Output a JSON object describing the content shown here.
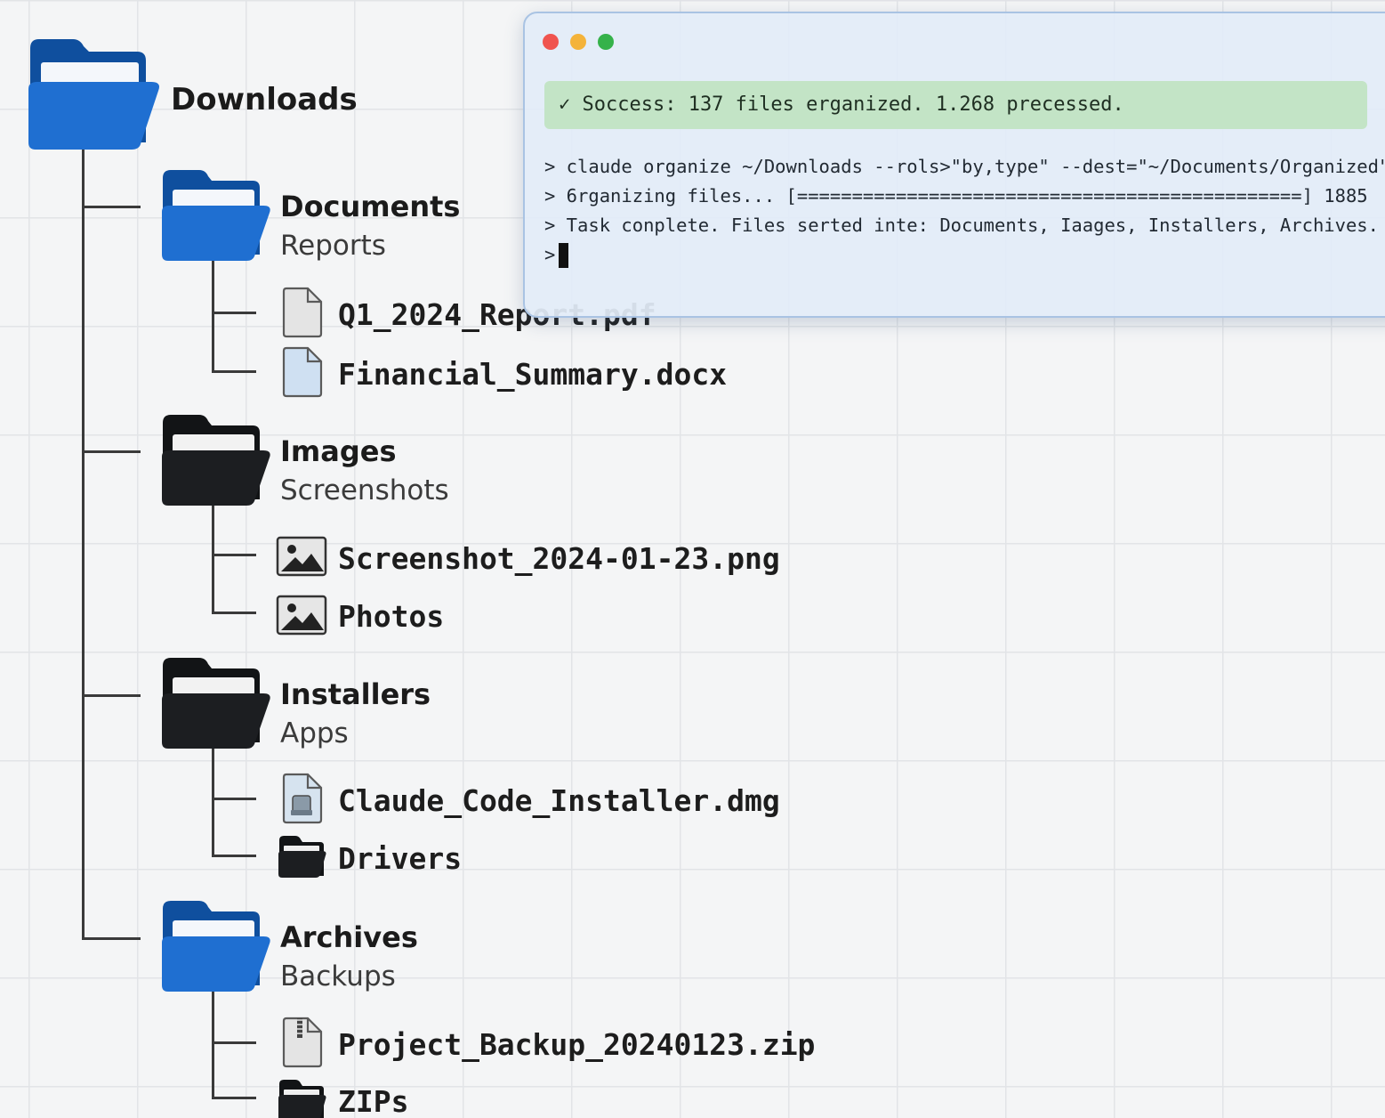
{
  "tree": {
    "root": {
      "name": "Downloads"
    },
    "folders": [
      {
        "name": "Documents",
        "subtitle": "Reports",
        "color": "blue",
        "children": [
          {
            "name": "Q1_2024_Report.pdf",
            "icon": "pdf-file-icon"
          },
          {
            "name": "Financial_Summary.docx",
            "icon": "docx-file-icon"
          }
        ]
      },
      {
        "name": "Images",
        "subtitle": "Screenshots",
        "color": "black",
        "children": [
          {
            "name": "Screenshot_2024-01-23.png",
            "icon": "image-file-icon"
          },
          {
            "name": "Photos",
            "icon": "image-file-icon"
          }
        ]
      },
      {
        "name": "Installers",
        "subtitle": "Apps",
        "color": "black",
        "children": [
          {
            "name": "Claude_Code_Installer.dmg",
            "icon": "dmg-file-icon"
          },
          {
            "name": "Drivers",
            "icon": "folder-icon"
          }
        ]
      },
      {
        "name": "Archives",
        "subtitle": "Backups",
        "color": "blue",
        "children": [
          {
            "name": "Project_Backup_20240123.zip",
            "icon": "zip-file-icon"
          },
          {
            "name": "ZIPs",
            "icon": "folder-icon"
          }
        ]
      }
    ]
  },
  "terminal": {
    "success": "✓ Soccess: 137 files erganized. 1.268 precessed.",
    "lines": [
      "> claude organize ~/Downloads --rols>\"by,type\" --dest=\"~/Documents/Organized\"",
      "> 6rganizing files... [==============================================] 1885",
      "> Task conplete. Files serted inte: Documents, Iaages, Installers, Archives."
    ],
    "prompt": ">"
  },
  "colors": {
    "folder_blue": "#1f6fd1",
    "folder_blue_dark": "#0f4f9e",
    "folder_black": "#1c1e21",
    "success_bg": "#c3e4c6",
    "dot_red": "#f0544f",
    "dot_yellow": "#f4b33a",
    "dot_green": "#35b24a"
  }
}
